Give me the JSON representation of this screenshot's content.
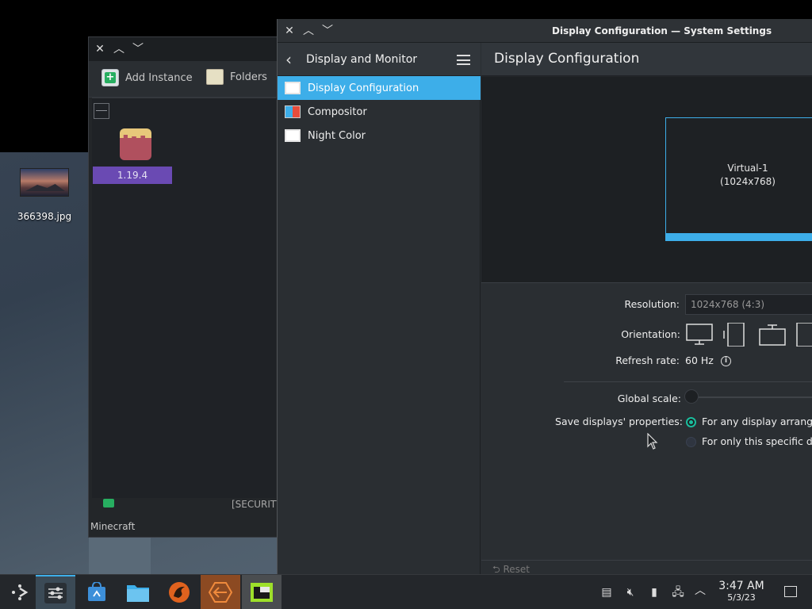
{
  "desktop": {
    "icon_label": "366398.jpg"
  },
  "minecraft": {
    "toolbar": {
      "add_instance": "Add Instance",
      "folders": "Folders"
    },
    "instance_label": "1.19.4",
    "status_text": "[SECURITY",
    "footer_label": "Minecraft"
  },
  "settings": {
    "window_title": "Display Configuration — System Settings",
    "sidebar": {
      "header": "Display and Monitor",
      "items": [
        {
          "label": "Display Configuration",
          "icon": "monitor-icon",
          "active": true
        },
        {
          "label": "Compositor",
          "icon": "compositor-icon",
          "active": false
        },
        {
          "label": "Night Color",
          "icon": "monitor-icon",
          "active": false
        }
      ]
    },
    "main": {
      "title": "Display Configuration",
      "output_name": "Virtual-1",
      "output_res": "(1024x768)",
      "resolution_label": "Resolution:",
      "resolution_value": "1024x768 (4:3)",
      "orientation_label": "Orientation:",
      "refresh_label": "Refresh rate:",
      "refresh_value": "60 Hz",
      "global_scale_label": "Global scale:",
      "save_label": "Save displays' properties:",
      "save_options": [
        {
          "label": "For any display arranger",
          "checked": true
        },
        {
          "label": "For only this specific dis",
          "checked": false
        }
      ],
      "reset_label": "Reset"
    }
  },
  "taskbar": {
    "time": "3:47 AM",
    "date": "5/3/23"
  },
  "colors": {
    "accent": "#3daee9",
    "radio_on": "#1abc9c",
    "instance_bg": "#6a4ab3"
  }
}
